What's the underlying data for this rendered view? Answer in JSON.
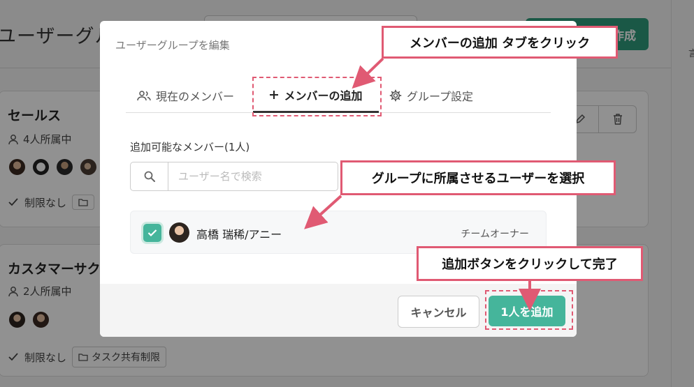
{
  "background": {
    "page_title": "ユーザーグル",
    "create_button": "作成",
    "right_char": "言",
    "cards": [
      {
        "name": "セールス",
        "member_count": "4人所属中",
        "limit": "制限なし",
        "chip": ""
      },
      {
        "name": "カスタマーサク",
        "member_count": "2人所属中",
        "limit": "制限なし",
        "chip": "タスク共有制限"
      }
    ]
  },
  "modal": {
    "title": "ユーザーグループを編集",
    "tabs": {
      "current": "現在のメンバー",
      "add": "メンバーの追加",
      "settings": "グループ設定"
    },
    "available_label": "追加可能なメンバー(1人)",
    "search": {
      "placeholder": "ユーザー名で検索"
    },
    "member": {
      "name": "高橋 瑞稀/アニー",
      "role": "チームオーナー",
      "checked": true
    },
    "footer": {
      "cancel": "キャンセル",
      "add": "1人を追加"
    }
  },
  "annotations": {
    "step1": "メンバーの追加 タブをクリック",
    "step2": "グループに所属させるユーザーを選択",
    "step3": "追加ボタンをクリックして完了",
    "accent_color": "#e05a73"
  },
  "colors": {
    "primary": "#45b59b",
    "overlay": "rgba(0,0,0,0.43)"
  }
}
